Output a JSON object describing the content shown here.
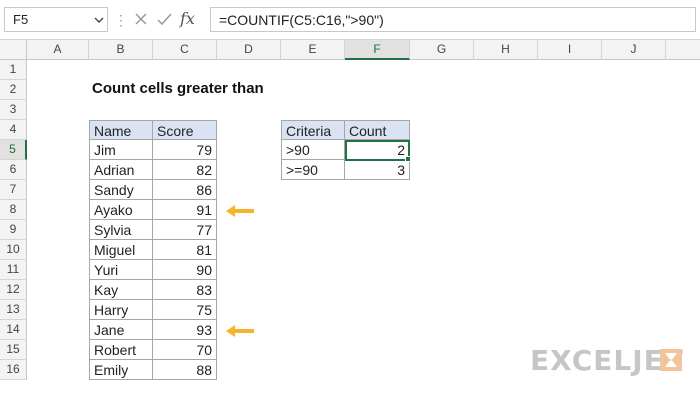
{
  "name_box": {
    "value": "F5"
  },
  "formula_bar": {
    "formula": "=COUNTIF(C5:C16,\">90\")",
    "fx_label": "fx"
  },
  "columns": [
    "A",
    "B",
    "C",
    "D",
    "E",
    "F",
    "G",
    "H",
    "I",
    "J"
  ],
  "rows": [
    "1",
    "2",
    "3",
    "4",
    "5",
    "6",
    "7",
    "8",
    "9",
    "10",
    "11",
    "12",
    "13",
    "14",
    "15",
    "16"
  ],
  "selected_cell": {
    "column": "F",
    "row": "5"
  },
  "title": "Count cells greater than",
  "score_table": {
    "headers": [
      "Name",
      "Score"
    ],
    "rows": [
      {
        "name": "Jim",
        "score": "79"
      },
      {
        "name": "Adrian",
        "score": "82"
      },
      {
        "name": "Sandy",
        "score": "86"
      },
      {
        "name": "Ayako",
        "score": "91"
      },
      {
        "name": "Sylvia",
        "score": "77"
      },
      {
        "name": "Miguel",
        "score": "81"
      },
      {
        "name": "Yuri",
        "score": "90"
      },
      {
        "name": "Kay",
        "score": "83"
      },
      {
        "name": "Harry",
        "score": "75"
      },
      {
        "name": "Jane",
        "score": "93"
      },
      {
        "name": "Robert",
        "score": "70"
      },
      {
        "name": "Emily",
        "score": "88"
      }
    ]
  },
  "criteria_table": {
    "headers": [
      "Criteria",
      "Count"
    ],
    "rows": [
      {
        "criteria": ">90",
        "count": "2"
      },
      {
        "criteria": ">=90",
        "count": "3"
      }
    ]
  },
  "arrow_color": "#f5b52b",
  "brand": {
    "text": "EXCELJET",
    "icon": "exceljet-logo-icon"
  }
}
